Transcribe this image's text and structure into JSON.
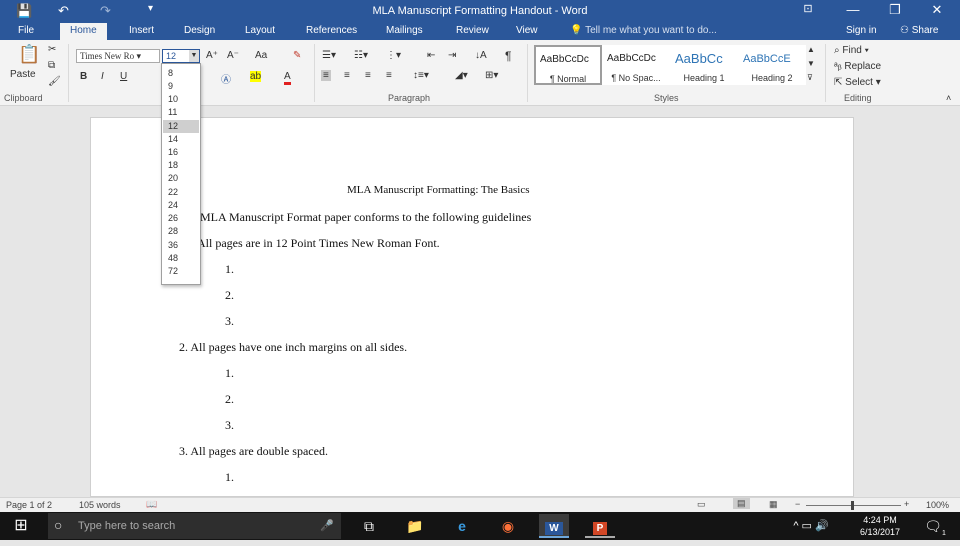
{
  "window": {
    "title": "MLA Manuscript Formatting Handout - Word",
    "minimize": "—",
    "restore": "❐",
    "close": "✕",
    "ribbon_opts": "⊡"
  },
  "quick_access": {
    "save": "💾",
    "undo": "↶",
    "redo": "↷",
    "customize": "▾"
  },
  "tabs": [
    "File",
    "Home",
    "Insert",
    "Design",
    "Layout",
    "References",
    "Mailings",
    "Review",
    "View"
  ],
  "tell_me": "Tell me what you want to do...",
  "sign_in": "Sign in",
  "share": "Share",
  "ribbon": {
    "clipboard": {
      "label": "Clipboard",
      "paste": "Paste"
    },
    "font": {
      "family": "Times New Ro",
      "size": "12",
      "bold": "B",
      "italic": "I",
      "underline": "U",
      "grow": "A⁺",
      "shrink": "A⁻",
      "case": "Aa",
      "clear": "✎"
    },
    "paragraph": {
      "label": "Paragraph",
      "pilcrow": "¶"
    },
    "styles": {
      "label": "Styles",
      "items": [
        {
          "sample": "AaBbCcDc",
          "name": "¶ Normal"
        },
        {
          "sample": "AaBbCcDc",
          "name": "¶ No Spac..."
        },
        {
          "sample": "AaBbCc",
          "name": "Heading 1"
        },
        {
          "sample": "AaBbCcE",
          "name": "Heading 2"
        }
      ]
    },
    "editing": {
      "label": "Editing",
      "find": "Find",
      "replace": "Replace",
      "select": "Select"
    }
  },
  "size_dropdown": {
    "options": [
      "8",
      "9",
      "10",
      "11",
      "12",
      "14",
      "16",
      "18",
      "20",
      "22",
      "24",
      "26",
      "28",
      "36",
      "48",
      "72"
    ],
    "selected": "12"
  },
  "document": {
    "title": "MLA Manuscript Formatting: The Basics",
    "intro": "MLA Manuscript Format paper conforms to the following guidelines",
    "item1": "All pages are in 12 Point Times New Roman Font.",
    "item2": "2.  All pages have one inch margins on all sides.",
    "item3": "3.  All pages are double spaced.",
    "sub1": "1.",
    "sub2": "2.",
    "sub3": "3."
  },
  "status": {
    "page": "Page 1 of 2",
    "words": "105 words",
    "zoom": "100%",
    "minus": "−",
    "plus": "+"
  },
  "taskbar": {
    "search_placeholder": "Type here to search",
    "time": "4:24 PM",
    "date": "6/13/2017",
    "notif": "1"
  }
}
